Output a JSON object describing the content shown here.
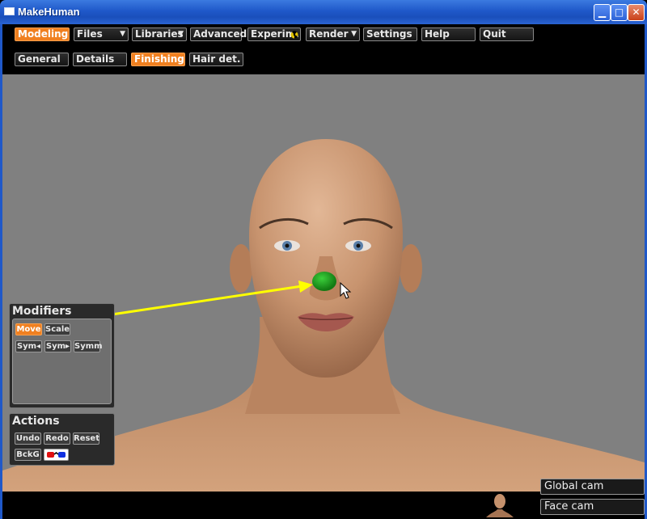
{
  "window": {
    "title": "MakeHuman",
    "min_glyph": "▁",
    "max_glyph": "□",
    "close_glyph": "✕"
  },
  "menu": {
    "tabs": [
      {
        "label": "Modeling",
        "active": true
      },
      {
        "label": "Files",
        "dropdown": true
      },
      {
        "label": "Libraries",
        "dropdown": true
      },
      {
        "label": "Advanced"
      },
      {
        "label": "Experim."
      },
      {
        "label": "Render",
        "dropdown": true
      },
      {
        "label": "Settings"
      },
      {
        "label": "Help"
      },
      {
        "label": "Quit"
      }
    ],
    "subtabs": [
      {
        "label": "General"
      },
      {
        "label": "Details"
      },
      {
        "label": "Finishing",
        "active": true
      },
      {
        "label": "Hair det."
      }
    ],
    "dropdown_glyph": "▼"
  },
  "modifiers": {
    "title": "Modifiers",
    "buttons": [
      "Move",
      "Scale"
    ],
    "symmetry": [
      "Sym◂",
      "Sym▸",
      "Symm"
    ]
  },
  "actions": {
    "title": "Actions",
    "buttons": [
      "Undo",
      "Redo",
      "Reset"
    ],
    "background": "BckG"
  },
  "cameras": {
    "global": "Global cam",
    "face": "Face cam"
  },
  "colors": {
    "accent": "#f08020",
    "viewport": "#808080",
    "annotation_arrow": "#ffff00",
    "target_marker": "#1f9a1f"
  }
}
